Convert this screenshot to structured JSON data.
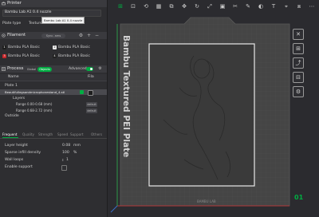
{
  "printer": {
    "section_title": "Printer",
    "selected": "Bambu Lab A1 0.4 nozzle",
    "tooltip": "Bambu Lab A1 0.4 nozzle",
    "plate_type_label": "Plate type",
    "plate_type_value": "Textured"
  },
  "filament": {
    "section_title": "Filament",
    "sync_label": "Sync. ams",
    "slots": [
      {
        "num": "1",
        "name": "Bambu PLA Basic",
        "color": "#1e1e1e"
      },
      {
        "num": "2",
        "name": "Bambu PLA Basic",
        "color": "#e8e8e8"
      },
      {
        "num": "3",
        "name": "Bambu PLA Basic",
        "color": "#c8262a"
      },
      {
        "num": "4",
        "name": "Bambu PLA Basic",
        "color": "#222222"
      }
    ]
  },
  "process": {
    "section_title": "Process",
    "tab_global": "Global",
    "tab_objects": "Objects",
    "advanced_label": "Advanced"
  },
  "objects": {
    "col_name": "Name",
    "col_fil": "Fila",
    "plate": "Plate 1",
    "object_name": "Beautifullegsandmicrophonestand_4.stl",
    "layers": "Layers",
    "ranges": [
      {
        "label": "Range 0.00-0.68 (mm)",
        "tag": "default"
      },
      {
        "label": "Range 0.68-2.72 (mm)",
        "tag": "default"
      }
    ],
    "outside": "Outside"
  },
  "settings": {
    "tabs": [
      "Frequent",
      "Quality",
      "Strength",
      "Speed",
      "Support",
      "Others"
    ],
    "layer_height_label": "Layer height",
    "layer_height_value": "0.08",
    "layer_height_unit": "mm",
    "infill_label": "Sparse infill density",
    "infill_value": "100",
    "infill_unit": "%",
    "walls_label": "Wall loops",
    "walls_value": "1",
    "support_label": "Enable support"
  },
  "plate": {
    "brand_text": "Bambu Textured PEI Plate",
    "plate_number": "01",
    "bottom_label": "BAMBU LAB"
  },
  "colors": {
    "accent": "#00ae42",
    "bed": "#454545",
    "panel": "#2e2e31"
  }
}
